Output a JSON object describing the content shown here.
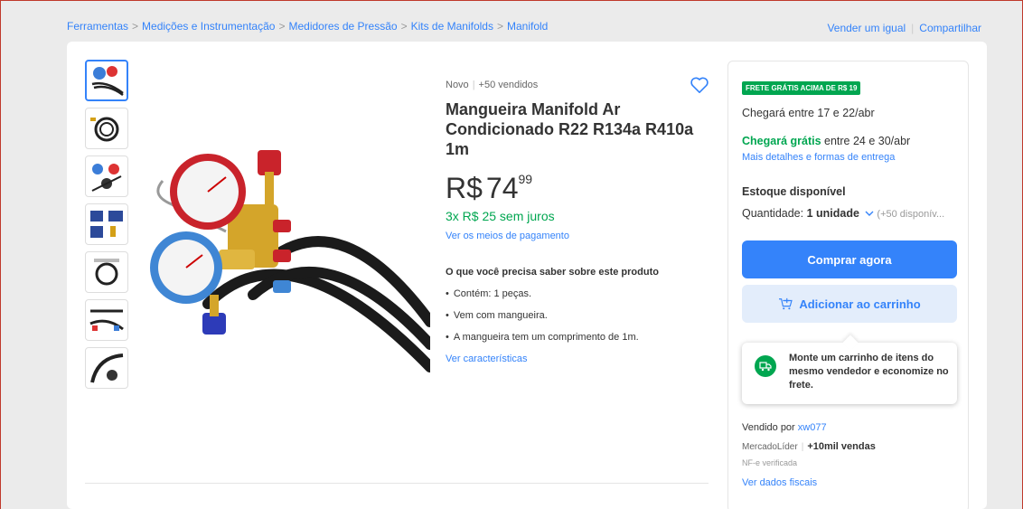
{
  "breadcrumb": [
    "Ferramentas",
    "Medições e Instrumentação",
    "Medidores de Pressão",
    "Kits de Manifolds",
    "Manifold"
  ],
  "breadcrumb_sep": ">",
  "top_actions": {
    "sell": "Vender um igual",
    "share": "Compartilhar"
  },
  "product": {
    "condition": "Novo",
    "sold": "+50 vendidos",
    "title": "Mangueira Manifold Ar Condicionado R22 R134a R410a 1m",
    "currency": "R$",
    "price_int": "74",
    "price_cents": "99",
    "installments": "3x R$ 25 sem juros",
    "payment_link": "Ver os meios de pagamento",
    "know_title": "O que você precisa saber sobre este produto",
    "bullets": [
      "Contém: 1 peças.",
      "Vem com mangueira.",
      "A mangueira tem um comprimento de 1m."
    ],
    "chars_link": "Ver características",
    "thumbnail_count": 7
  },
  "buybox": {
    "badge": "FRETE GRÁTIS ACIMA DE R$ 19",
    "arrival1": "Chegará entre 17 e 22/abr",
    "arrival2_green": "Chegará grátis",
    "arrival2_rest": " entre 24 e 30/abr",
    "delivery_link": "Mais detalhes e formas de entrega",
    "stock_title": "Estoque disponível",
    "qty_label": "Quantidade: ",
    "qty_value": "1 unidade",
    "qty_avail": "(+50 disponív...",
    "buy_now": "Comprar agora",
    "add_cart": "Adicionar ao carrinho",
    "tooltip": "Monte um carrinho de itens do mesmo vendedor e economize no frete.",
    "sold_by": "Vendido por ",
    "seller_name": "xw077",
    "ml_label": "MercadoLíder",
    "ml_sales": "+10mil vendas",
    "nfe": "NF-e verificada",
    "fiscal": "Ver dados fiscais"
  },
  "colors": {
    "accent": "#3483fa",
    "green": "#00a650",
    "bg": "#ebebeb"
  },
  "icons": [
    "heart-icon",
    "cart-plus-icon",
    "truck-icon",
    "chevron-down-icon"
  ]
}
